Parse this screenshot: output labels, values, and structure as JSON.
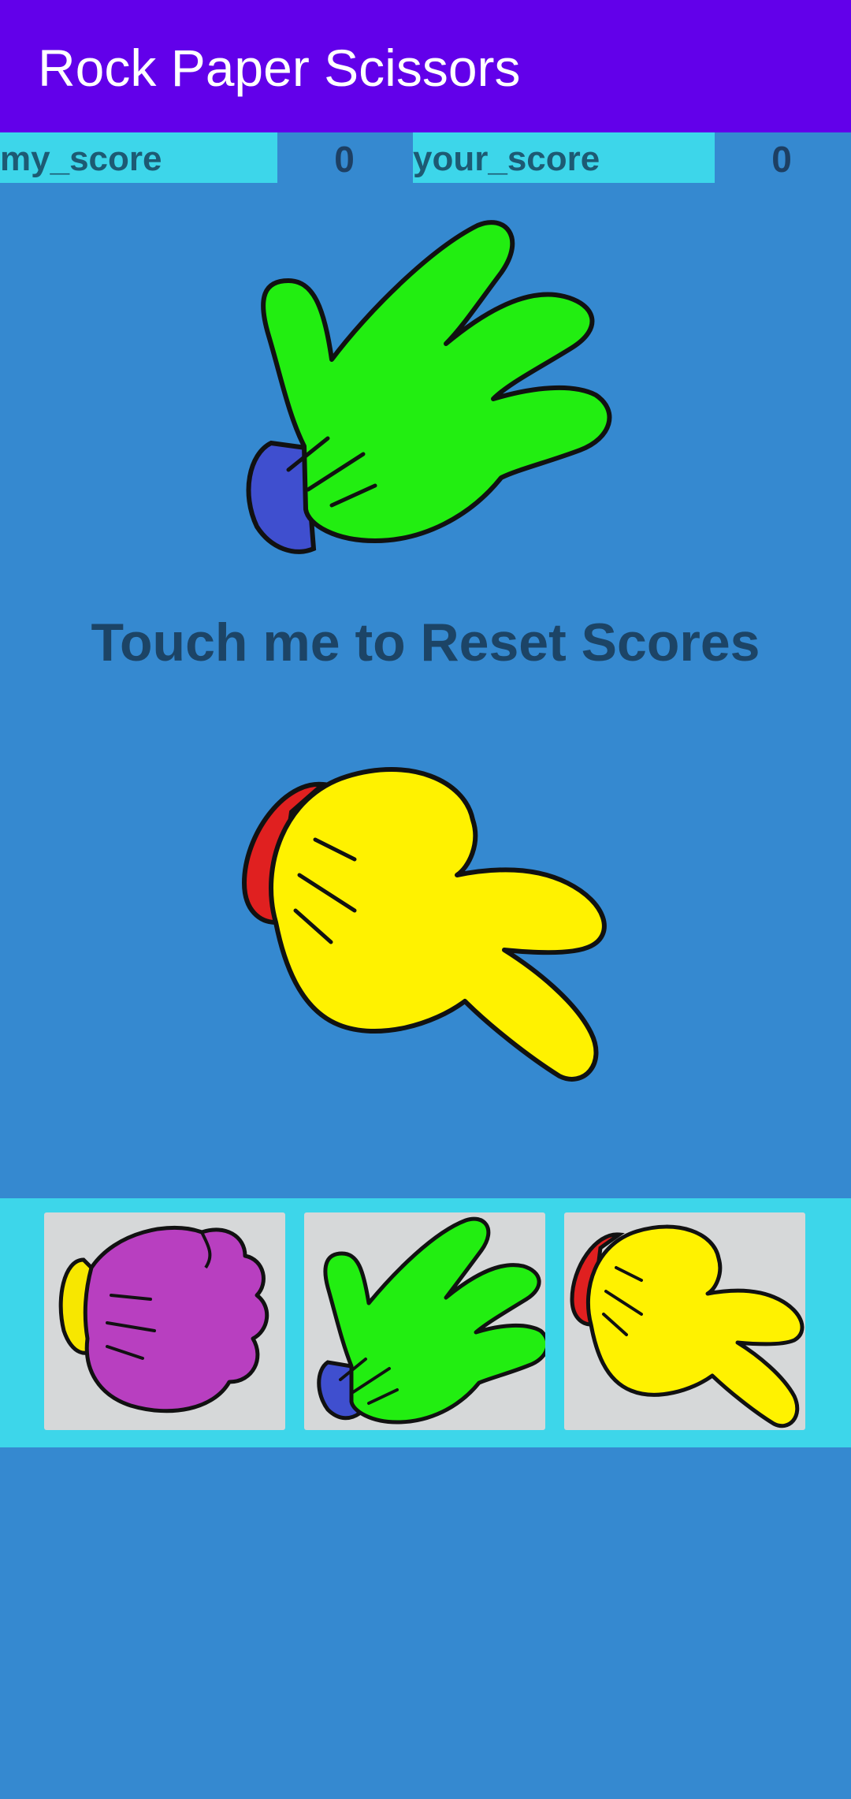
{
  "app": {
    "title": "Rock Paper Scissors",
    "accent": "#6200ea",
    "background": "#3589d0",
    "highlight": "#3dd6ea"
  },
  "scores": {
    "my_label": "my_score",
    "my_value": "0",
    "your_label": "your_score",
    "your_value": "0"
  },
  "opponent_hand": {
    "icon": "paper-hand-icon",
    "glove_color": "#22ee11",
    "cuff_color": "#3f4fcf"
  },
  "reset": {
    "label": "Touch me to Reset Scores"
  },
  "player_hand": {
    "icon": "scissors-hand-icon",
    "glove_color": "#fff200",
    "cuff_color": "#e02020"
  },
  "choices": [
    {
      "name": "rock",
      "icon": "rock-hand-icon",
      "glove_color": "#b83fc0",
      "cuff_color": "#f7e700"
    },
    {
      "name": "paper",
      "icon": "paper-hand-icon",
      "glove_color": "#22ee11",
      "cuff_color": "#3f4fcf"
    },
    {
      "name": "scissors",
      "icon": "scissors-hand-icon",
      "glove_color": "#fff200",
      "cuff_color": "#e02020"
    }
  ]
}
